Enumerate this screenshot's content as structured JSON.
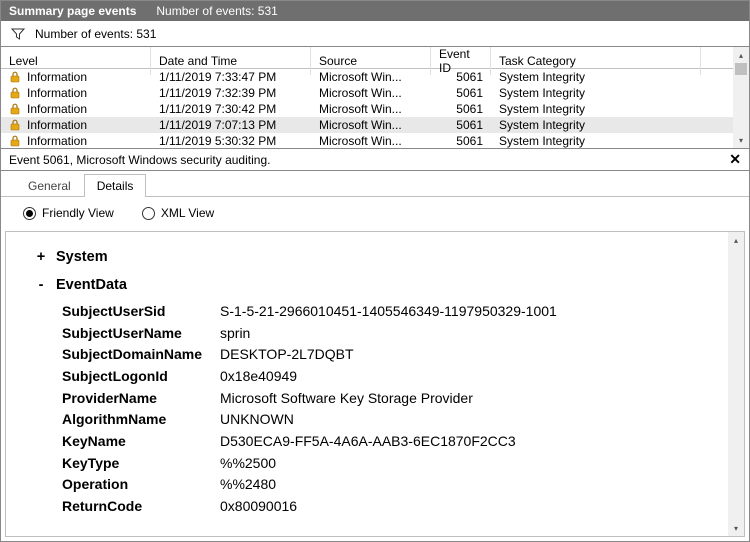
{
  "header": {
    "title": "Summary page events",
    "subtitle": "Number of events: 531"
  },
  "filter": {
    "text": "Number of events: 531"
  },
  "columns": {
    "level": "Level",
    "datetime": "Date and Time",
    "source": "Source",
    "eventid": "Event ID",
    "taskcat": "Task Category"
  },
  "events": [
    {
      "level": "Information",
      "datetime": "1/11/2019 7:33:47 PM",
      "source": "Microsoft Win...",
      "eventid": "5061",
      "taskcat": "System Integrity",
      "selected": false
    },
    {
      "level": "Information",
      "datetime": "1/11/2019 7:32:39 PM",
      "source": "Microsoft Win...",
      "eventid": "5061",
      "taskcat": "System Integrity",
      "selected": false
    },
    {
      "level": "Information",
      "datetime": "1/11/2019 7:30:42 PM",
      "source": "Microsoft Win...",
      "eventid": "5061",
      "taskcat": "System Integrity",
      "selected": false
    },
    {
      "level": "Information",
      "datetime": "1/11/2019 7:07:13 PM",
      "source": "Microsoft Win...",
      "eventid": "5061",
      "taskcat": "System Integrity",
      "selected": true
    },
    {
      "level": "Information",
      "datetime": "1/11/2019 5:30:32 PM",
      "source": "Microsoft Win...",
      "eventid": "5061",
      "taskcat": "System Integrity",
      "selected": false
    }
  ],
  "detail": {
    "title": "Event 5061, Microsoft Windows security auditing.",
    "tabs": {
      "general": "General",
      "details": "Details",
      "active": "details"
    },
    "views": {
      "friendly": "Friendly View",
      "xml": "XML View",
      "selected": "friendly"
    },
    "tree": {
      "system": {
        "label": "System",
        "expanded": false,
        "toggler": "+"
      },
      "eventdata": {
        "label": "EventData",
        "expanded": true,
        "toggler": "-",
        "fields": [
          {
            "k": "SubjectUserSid",
            "v": "S-1-5-21-2966010451-1405546349-1197950329-1001"
          },
          {
            "k": "SubjectUserName",
            "v": "sprin"
          },
          {
            "k": "SubjectDomainName",
            "v": "DESKTOP-2L7DQBT"
          },
          {
            "k": "SubjectLogonId",
            "v": "0x18e40949"
          },
          {
            "k": "ProviderName",
            "v": "Microsoft Software Key Storage Provider"
          },
          {
            "k": "AlgorithmName",
            "v": "UNKNOWN"
          },
          {
            "k": "KeyName",
            "v": "D530ECA9-FF5A-4A6A-AAB3-6EC1870F2CC3"
          },
          {
            "k": "KeyType",
            "v": "%%2500"
          },
          {
            "k": "Operation",
            "v": "%%2480"
          },
          {
            "k": "ReturnCode",
            "v": "0x80090016"
          }
        ]
      }
    }
  }
}
